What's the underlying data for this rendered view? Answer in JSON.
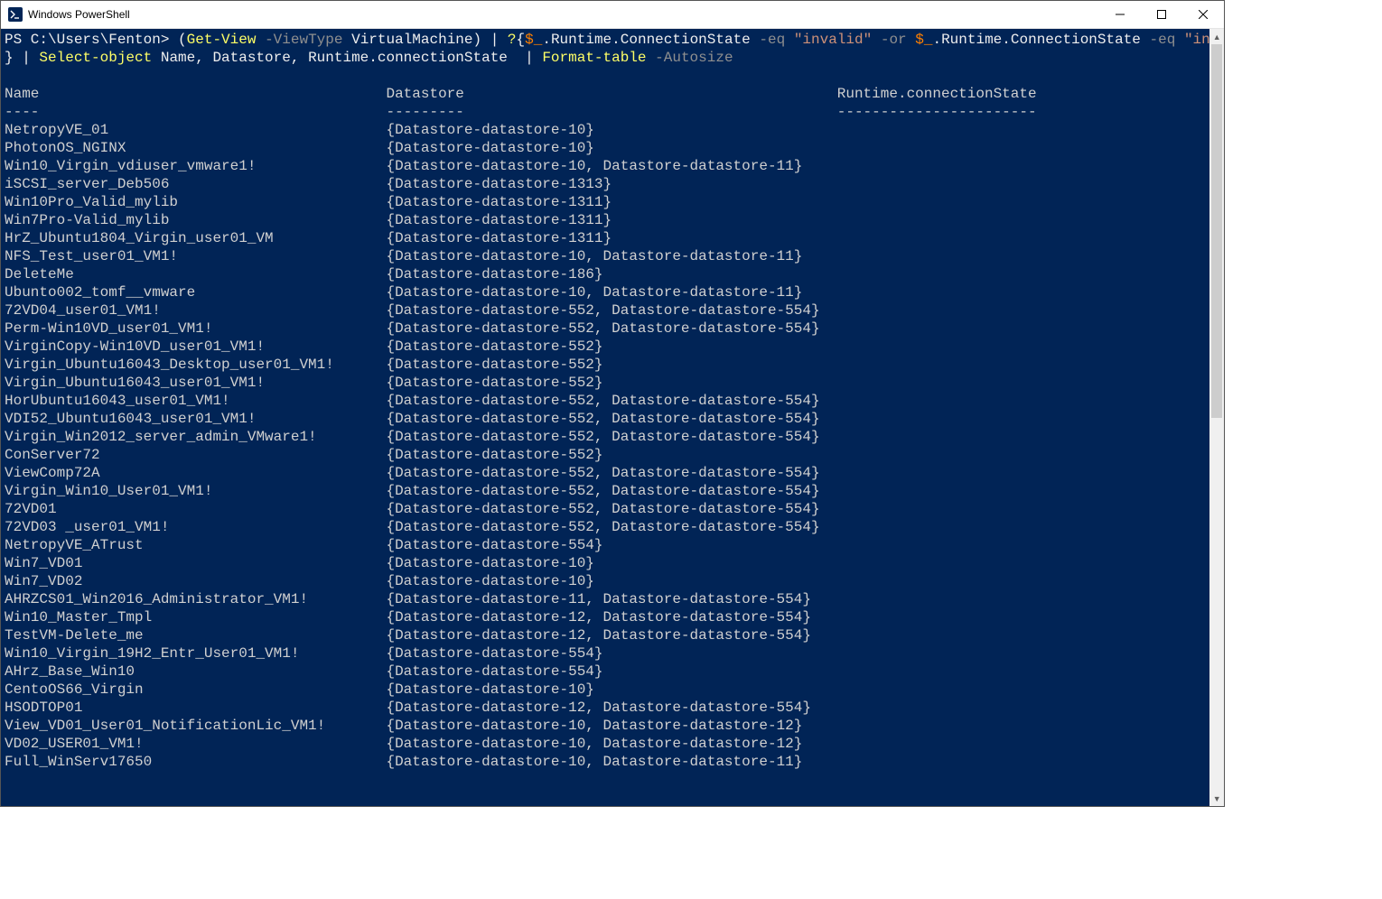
{
  "window": {
    "title": "Windows PowerShell"
  },
  "prompt": {
    "ps": "PS ",
    "path": "C:\\Users\\Fenton>",
    "sp": " ",
    "lp": "(",
    "cmd1": "Get-View",
    "sp2": " ",
    "opt1": "-ViewType",
    "sp3": " ",
    "arg1": "VirtualMachine",
    "rp_pipe": ") | ",
    "q": "?",
    "lb": "{",
    "dexp1": "$_",
    "dot1": ".Runtime.ConnectionState ",
    "eq1": "-eq",
    "sp4": " ",
    "str1": "\"invalid\"",
    "sp5": " ",
    "or": "-or",
    "sp6": " ",
    "dexp2": "$_",
    "dot2": ".Runtime.ConnectionState ",
    "eq2": "-eq",
    "sp7": " ",
    "str2": "\"inaccessible\"",
    "nl_rb": "}",
    "pipe2": " | ",
    "cmd2": "Select-object",
    "args2": " Name, Datastore, Runtime.connectionState  | ",
    "cmd3": "Format-table",
    "sp8": " ",
    "opt2": "-Autosize"
  },
  "headers": {
    "name": "Name",
    "datastore": "Datastore",
    "state": "Runtime.connectionState"
  },
  "dividers": {
    "name": "----",
    "datastore": "---------",
    "state": "-----------------------"
  },
  "cols": {
    "name_w": 44,
    "ds_w": 52
  },
  "rows": [
    {
      "name": "NetropyVE_01",
      "ds": "{Datastore-datastore-10}"
    },
    {
      "name": "PhotonOS_NGINX",
      "ds": "{Datastore-datastore-10}"
    },
    {
      "name": "Win10_Virgin_vdiuser_vmware1!",
      "ds": "{Datastore-datastore-10, Datastore-datastore-11}"
    },
    {
      "name": "iSCSI_server_Deb506",
      "ds": "{Datastore-datastore-1313}"
    },
    {
      "name": "Win10Pro_Valid_mylib",
      "ds": "{Datastore-datastore-1311}"
    },
    {
      "name": "Win7Pro-Valid_mylib",
      "ds": "{Datastore-datastore-1311}"
    },
    {
      "name": "HrZ_Ubuntu1804_Virgin_user01_VM",
      "ds": "{Datastore-datastore-1311}"
    },
    {
      "name": "NFS_Test_user01_VM1!",
      "ds": "{Datastore-datastore-10, Datastore-datastore-11}"
    },
    {
      "name": "DeleteMe",
      "ds": "{Datastore-datastore-186}"
    },
    {
      "name": "Ubunto002_tomf__vmware",
      "ds": "{Datastore-datastore-10, Datastore-datastore-11}"
    },
    {
      "name": "72VD04_user01_VM1!",
      "ds": "{Datastore-datastore-552, Datastore-datastore-554}"
    },
    {
      "name": "Perm-Win10VD_user01_VM1!",
      "ds": "{Datastore-datastore-552, Datastore-datastore-554}"
    },
    {
      "name": "VirginCopy-Win10VD_user01_VM1!",
      "ds": "{Datastore-datastore-552}"
    },
    {
      "name": "Virgin_Ubuntu16043_Desktop_user01_VM1!",
      "ds": "{Datastore-datastore-552}"
    },
    {
      "name": "Virgin_Ubuntu16043_user01_VM1!",
      "ds": "{Datastore-datastore-552}"
    },
    {
      "name": "HorUbuntu16043_user01_VM1!",
      "ds": "{Datastore-datastore-552, Datastore-datastore-554}"
    },
    {
      "name": "VDI52_Ubuntu16043_user01_VM1!",
      "ds": "{Datastore-datastore-552, Datastore-datastore-554}"
    },
    {
      "name": "Virgin_Win2012_server_admin_VMware1!",
      "ds": "{Datastore-datastore-552, Datastore-datastore-554}"
    },
    {
      "name": "ConServer72",
      "ds": "{Datastore-datastore-552}"
    },
    {
      "name": "ViewComp72A",
      "ds": "{Datastore-datastore-552, Datastore-datastore-554}"
    },
    {
      "name": "Virgin_Win10_User01_VM1!",
      "ds": "{Datastore-datastore-552, Datastore-datastore-554}"
    },
    {
      "name": "72VD01",
      "ds": "{Datastore-datastore-552, Datastore-datastore-554}"
    },
    {
      "name": "72VD03 _user01_VM1!",
      "ds": "{Datastore-datastore-552, Datastore-datastore-554}"
    },
    {
      "name": "NetropyVE_ATrust",
      "ds": "{Datastore-datastore-554}"
    },
    {
      "name": "Win7_VD01",
      "ds": "{Datastore-datastore-10}"
    },
    {
      "name": "Win7_VD02",
      "ds": "{Datastore-datastore-10}"
    },
    {
      "name": "AHRZCS01_Win2016_Administrator_VM1!",
      "ds": "{Datastore-datastore-11, Datastore-datastore-554}"
    },
    {
      "name": "Win10_Master_Tmpl",
      "ds": "{Datastore-datastore-12, Datastore-datastore-554}"
    },
    {
      "name": "TestVM-Delete_me",
      "ds": "{Datastore-datastore-12, Datastore-datastore-554}"
    },
    {
      "name": "Win10_Virgin_19H2_Entr_User01_VM1!",
      "ds": "{Datastore-datastore-554}"
    },
    {
      "name": "AHrz_Base_Win10",
      "ds": "{Datastore-datastore-554}"
    },
    {
      "name": "CentoOS66_Virgin",
      "ds": "{Datastore-datastore-10}"
    },
    {
      "name": "HSODTOP01",
      "ds": "{Datastore-datastore-12, Datastore-datastore-554}"
    },
    {
      "name": "View_VD01_User01_NotificationLic_VM1!",
      "ds": "{Datastore-datastore-10, Datastore-datastore-12}"
    },
    {
      "name": "VD02_USER01_VM1!",
      "ds": "{Datastore-datastore-10, Datastore-datastore-12}"
    },
    {
      "name": "Full_WinServ17650",
      "ds": "{Datastore-datastore-10, Datastore-datastore-11}"
    }
  ]
}
